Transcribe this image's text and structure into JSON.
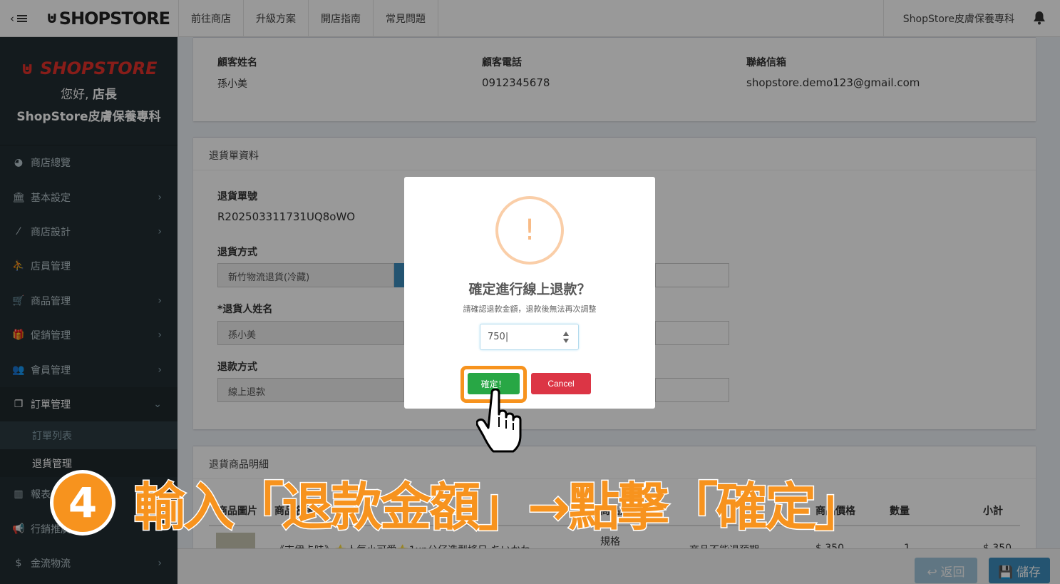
{
  "topbar": {
    "logo": "SHOPSTORE",
    "nav": [
      "前往商店",
      "升級方案",
      "開店指南",
      "常見問題"
    ],
    "store_name": "ShopStore皮膚保養專科"
  },
  "sidebar": {
    "logo": "SHOPSTORE",
    "greeting_prefix": "您好, ",
    "greeting_role": "店長",
    "store": "ShopStore皮膚保養專科",
    "items": [
      {
        "label": "商店總覽",
        "icon": "dashboard-icon"
      },
      {
        "label": "基本設定",
        "icon": "bank-icon"
      },
      {
        "label": "商店設計",
        "icon": "magic-wand-icon"
      },
      {
        "label": "店員管理",
        "icon": "user-icon"
      },
      {
        "label": "商品管理",
        "icon": "cart-icon"
      },
      {
        "label": "促銷管理",
        "icon": "gift-icon"
      },
      {
        "label": "會員管理",
        "icon": "users-icon"
      },
      {
        "label": "訂單管理",
        "icon": "files-icon"
      }
    ],
    "sub_items": [
      "訂單列表",
      "退貨管理"
    ],
    "items_after": [
      {
        "label": "報表",
        "icon": "bar-chart-icon"
      },
      {
        "label": "行銷推廣",
        "icon": "bullhorn-icon"
      },
      {
        "label": "金流物流",
        "icon": "dollar-icon"
      }
    ]
  },
  "customer": {
    "name_label": "顧客姓名",
    "name": "孫小美",
    "phone_label": "顧客電話",
    "phone": "0912345678",
    "email_label": "聯絡信箱",
    "email": "shopstore.demo123@gmail.com"
  },
  "return_info": {
    "title": "退貨單資料",
    "number_label": "退貨單號",
    "number": "R202503311731UQ8oWO",
    "method_label": "退貨方式",
    "method": "新竹物流退貨(冷藏)",
    "name_label": "*退貨人姓名",
    "name": "孫小美",
    "refund_label": "退款方式",
    "refund": "線上退款"
  },
  "return_items": {
    "title": "退貨商品明細",
    "columns": [
      "商品圖片",
      "商品名稱",
      "商品規格",
      "商品價格",
      "數量",
      "小計"
    ],
    "row": {
      "name": "《吉伊卡哇》⭐人氣小可愛⭐1xp公仔造型搖日 ちいかわ",
      "spec": "規格",
      "status": "商品不能退預期",
      "price": "$ 350",
      "qty": "1",
      "subtotal": "$ 350"
    }
  },
  "modal": {
    "title": "確定進行線上退款？",
    "text": "請確認退款金額，退款後無法再次調整",
    "amount": "750",
    "confirm": "確定！",
    "cancel": "Cancel"
  },
  "caption": {
    "step": "4",
    "text": "輸入「退款金額」→點擊「確定」"
  },
  "footer": {
    "back": "返回",
    "save": "儲存"
  }
}
